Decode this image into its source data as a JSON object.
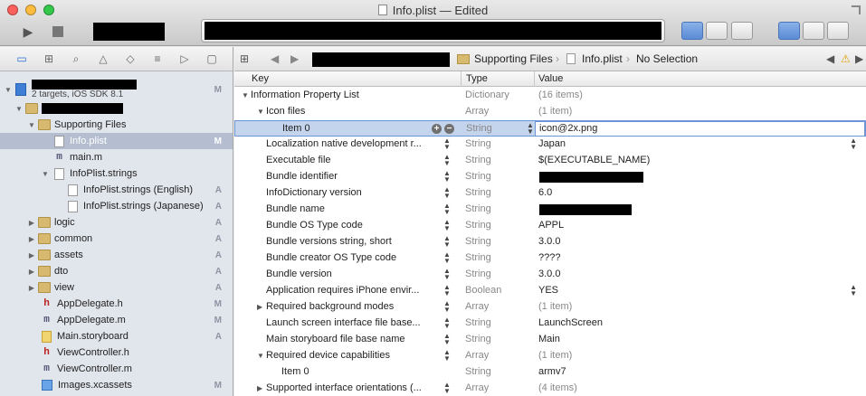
{
  "window": {
    "title": "Info.plist — Edited",
    "colors": {
      "close": "#fc605b",
      "minimize": "#fdbc40",
      "zoom": "#34c84a",
      "selection": "#c4d4ec",
      "accent": "#2b6fd6"
    }
  },
  "toolbar": {
    "run_icon": "play-icon",
    "stop_icon": "stop-icon"
  },
  "navigator": {
    "project_subtitle": "2 targets, iOS SDK 8.1",
    "items": [
      {
        "label": "Supporting Files",
        "badge": ""
      },
      {
        "label": "Info.plist",
        "badge": "M"
      },
      {
        "label": "main.m",
        "badge": ""
      },
      {
        "label": "InfoPlist.strings",
        "badge": ""
      },
      {
        "label": "InfoPlist.strings (English)",
        "badge": "A"
      },
      {
        "label": "InfoPlist.strings (Japanese)",
        "badge": "A"
      },
      {
        "label": "logic",
        "badge": "A"
      },
      {
        "label": "common",
        "badge": "A"
      },
      {
        "label": "assets",
        "badge": "A"
      },
      {
        "label": "dto",
        "badge": "A"
      },
      {
        "label": "view",
        "badge": "A"
      },
      {
        "label": "AppDelegate.h",
        "badge": "M"
      },
      {
        "label": "AppDelegate.m",
        "badge": "M"
      },
      {
        "label": "Main.storyboard",
        "badge": "A"
      },
      {
        "label": "ViewController.h",
        "badge": ""
      },
      {
        "label": "ViewController.m",
        "badge": ""
      },
      {
        "label": "Images.xcassets",
        "badge": "M"
      }
    ],
    "project_badge": "M"
  },
  "jumpbar": {
    "crumbs": [
      "Supporting Files",
      "Info.plist",
      "No Selection"
    ]
  },
  "plist": {
    "headers": {
      "key": "Key",
      "type": "Type",
      "value": "Value"
    },
    "rows": [
      {
        "key": "Information Property List",
        "type": "Dictionary",
        "value": "(16 items)"
      },
      {
        "key": "Icon files",
        "type": "Array",
        "value": "(1 item)"
      },
      {
        "key": "Item 0",
        "type": "String",
        "value": "icon@2x.png"
      },
      {
        "key": "Localization native development r...",
        "type": "String",
        "value": "Japan"
      },
      {
        "key": "Executable file",
        "type": "String",
        "value": "$(EXECUTABLE_NAME)"
      },
      {
        "key": "Bundle identifier",
        "type": "String",
        "value": ""
      },
      {
        "key": "InfoDictionary version",
        "type": "String",
        "value": "6.0"
      },
      {
        "key": "Bundle name",
        "type": "String",
        "value": ""
      },
      {
        "key": "Bundle OS Type code",
        "type": "String",
        "value": "APPL"
      },
      {
        "key": "Bundle versions string, short",
        "type": "String",
        "value": "3.0.0"
      },
      {
        "key": "Bundle creator OS Type code",
        "type": "String",
        "value": "????"
      },
      {
        "key": "Bundle version",
        "type": "String",
        "value": "3.0.0"
      },
      {
        "key": "Application requires iPhone envir...",
        "type": "Boolean",
        "value": "YES"
      },
      {
        "key": "Required background modes",
        "type": "Array",
        "value": "(1 item)"
      },
      {
        "key": "Launch screen interface file base...",
        "type": "String",
        "value": "LaunchScreen"
      },
      {
        "key": "Main storyboard file base name",
        "type": "String",
        "value": "Main"
      },
      {
        "key": "Required device capabilities",
        "type": "Array",
        "value": "(1 item)"
      },
      {
        "key": "Item 0",
        "type": "String",
        "value": "armv7"
      },
      {
        "key": "Supported interface orientations (...",
        "type": "Array",
        "value": "(4 items)"
      }
    ]
  }
}
